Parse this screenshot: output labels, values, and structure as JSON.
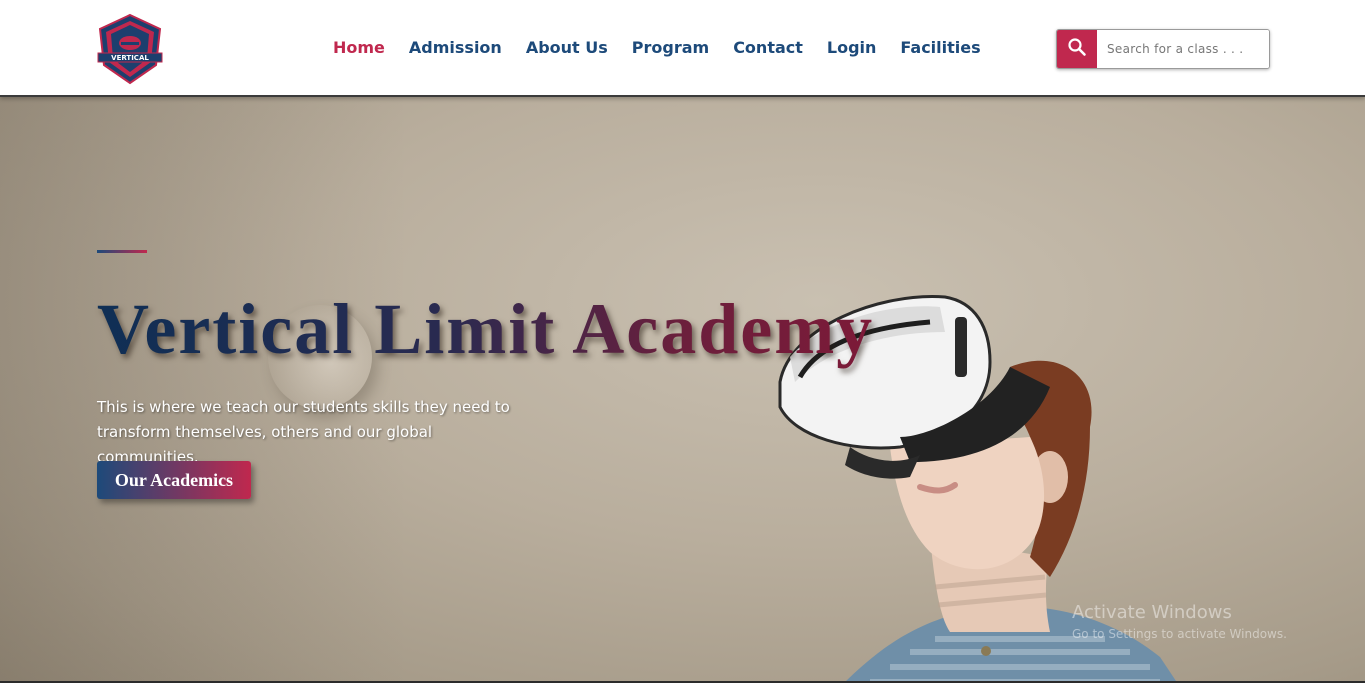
{
  "brand": {
    "logo_text": "VERTICAL",
    "colors": {
      "primary_blue": "#1d4a7a",
      "accent_red": "#c0284e"
    }
  },
  "nav": {
    "items": [
      {
        "label": "Home",
        "active": true
      },
      {
        "label": "Admission",
        "active": false
      },
      {
        "label": "About Us",
        "active": false
      },
      {
        "label": "Program",
        "active": false
      },
      {
        "label": "Contact",
        "active": false
      },
      {
        "label": "Login",
        "active": false
      },
      {
        "label": "Facilities",
        "active": false
      }
    ]
  },
  "search": {
    "icon": "search-icon",
    "placeholder": "Search for a class . . ."
  },
  "hero": {
    "title": "Vertical Limit Academy",
    "subtitle": "This is where we teach our students skills they need to transform themselves, others and our global communities.",
    "cta_label": "Our Academics"
  },
  "watermark": {
    "line1": "Activate Windows",
    "line2": "Go to Settings to activate Windows."
  }
}
